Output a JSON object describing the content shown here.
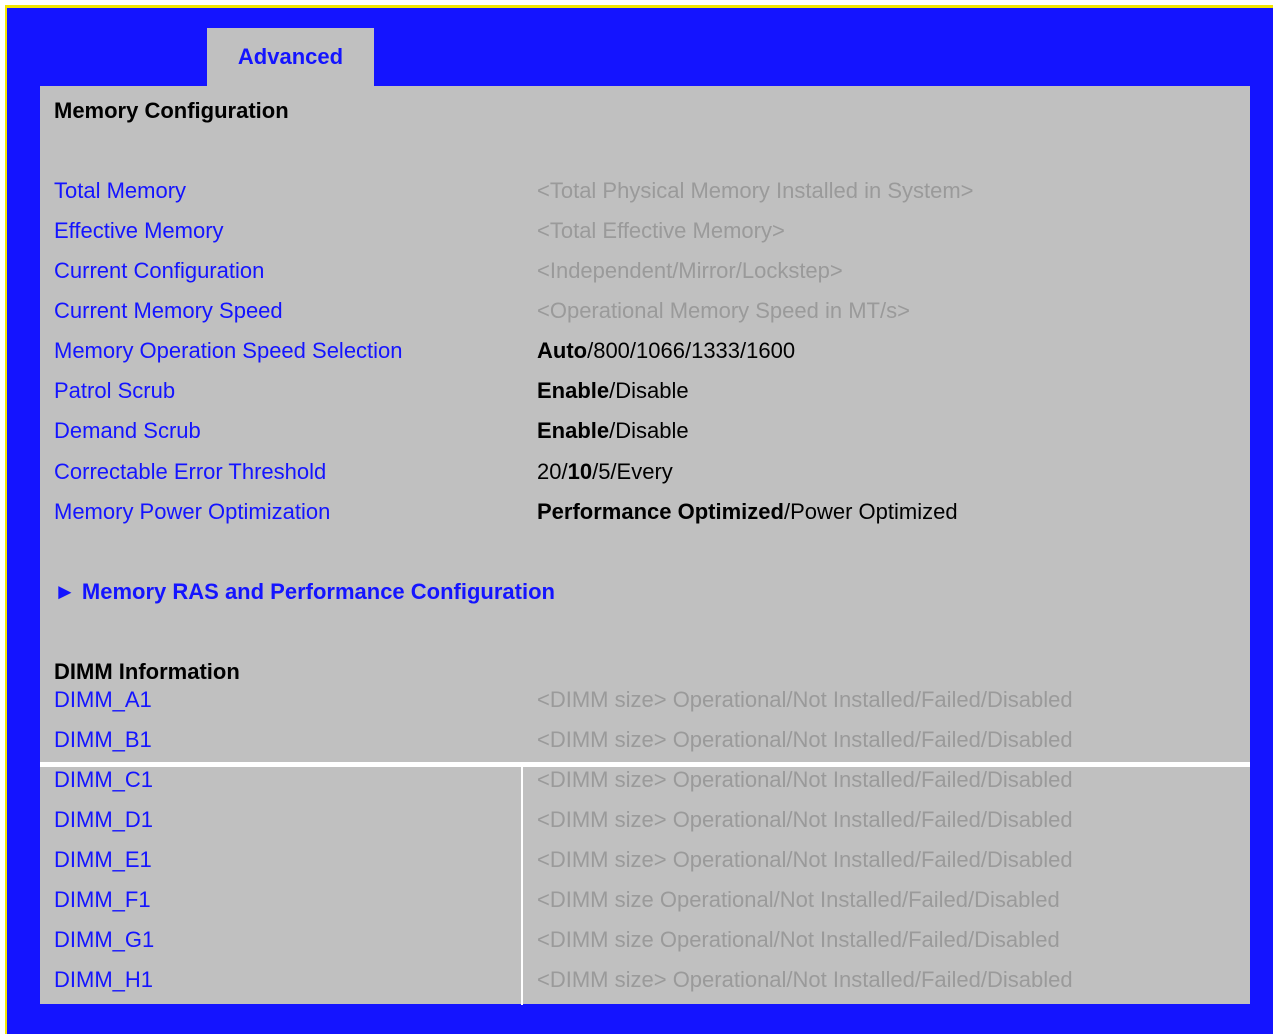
{
  "tab": {
    "label": "Advanced"
  },
  "section_title": "Memory Configuration",
  "info_rows": [
    {
      "label": "Total Memory",
      "value": "<Total Physical Memory Installed in System>"
    },
    {
      "label": "Effective Memory",
      "value": "<Total Effective Memory>"
    },
    {
      "label": "Current Configuration",
      "value": "<Independent/Mirror/Lockstep>"
    },
    {
      "label": "Current Memory Speed",
      "value": "<Operational Memory Speed in MT/s>"
    }
  ],
  "option_rows": [
    {
      "label": "Memory Operation Speed Selection",
      "pre": "",
      "bold": "Auto",
      "post": "/800/1066/1333/1600"
    },
    {
      "label": "Patrol Scrub",
      "pre": "",
      "bold": "Enable",
      "post": "/Disable"
    },
    {
      "label": "Demand Scrub",
      "pre": "",
      "bold": "Enable",
      "post": "/Disable"
    },
    {
      "label": "Correctable Error Threshold",
      "pre": "20/",
      "bold": "10",
      "post": "/5/Every"
    },
    {
      "label": "Memory Power Optimization",
      "pre": "",
      "bold": "Performance Optimized",
      "post": "/Power Optimized"
    }
  ],
  "submenu": {
    "arrow": "►",
    "label": "Memory RAS and Performance Configuration"
  },
  "dimm_heading": "DIMM Information",
  "dimm_rows": [
    {
      "label": "DIMM_A1",
      "value": "<DIMM size> Operational/Not Installed/Failed/Disabled"
    },
    {
      "label": "DIMM_B1",
      "value": "<DIMM size> Operational/Not Installed/Failed/Disabled"
    },
    {
      "label": "DIMM_C1",
      "value": "<DIMM size> Operational/Not Installed/Failed/Disabled"
    },
    {
      "label": "DIMM_D1",
      "value": "<DIMM size> Operational/Not Installed/Failed/Disabled"
    },
    {
      "label": "DIMM_E1",
      "value": "<DIMM size> Operational/Not Installed/Failed/Disabled"
    },
    {
      "label": "DIMM_F1",
      "value": "<DIMM size Operational/Not Installed/Failed/Disabled"
    },
    {
      "label": "DIMM_G1",
      "value": "<DIMM size Operational/Not Installed/Failed/Disabled"
    },
    {
      "label": "DIMM_H1",
      "value": "<DIMM size> Operational/Not Installed/Failed/Disabled"
    }
  ],
  "colors": {
    "frame": "#1414ff",
    "panel": "#c0c0c0",
    "label": "#1414ff",
    "readonly_value": "#9a9a9a",
    "border_accent": "#f3e600"
  }
}
